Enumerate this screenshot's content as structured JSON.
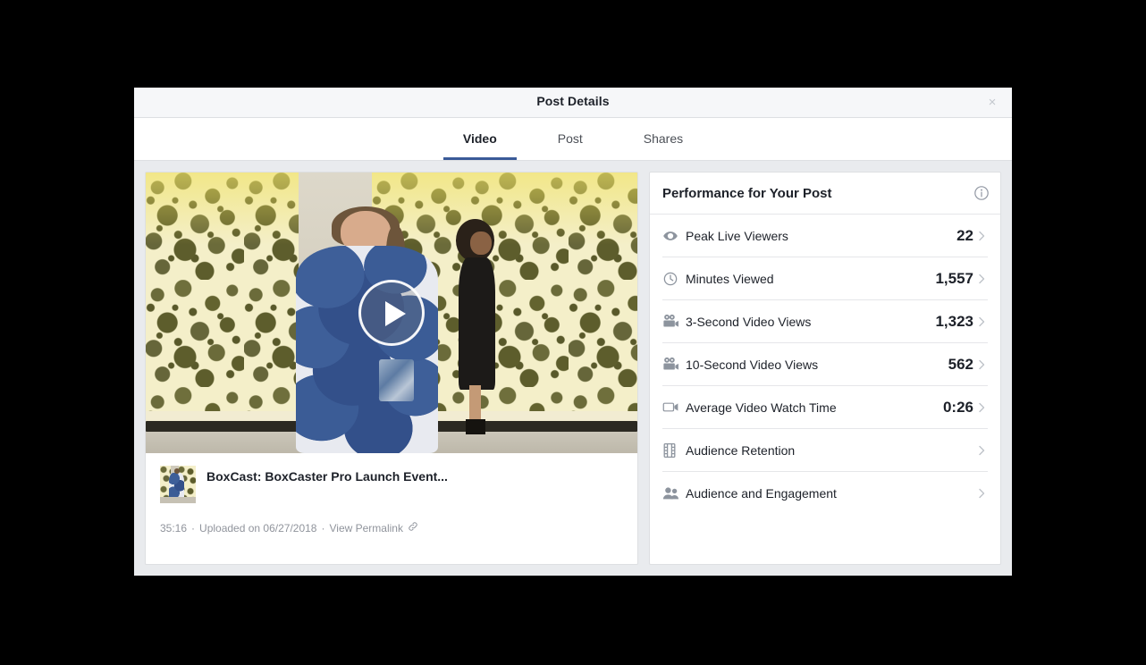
{
  "modal": {
    "title": "Post Details",
    "close_label": "×",
    "close_icon": "close-icon"
  },
  "tabs": [
    {
      "label": "Video",
      "active": true
    },
    {
      "label": "Post",
      "active": false
    },
    {
      "label": "Shares",
      "active": false
    }
  ],
  "video": {
    "play_icon": "play-icon",
    "title": "BoxCast: BoxCaster Pro Launch Event...",
    "duration": "35:16",
    "separator": "·",
    "uploaded": "Uploaded on 06/27/2018",
    "permalink_label": "View Permalink",
    "permalink_icon": "link-icon"
  },
  "performance": {
    "title": "Performance for Your Post",
    "info_icon": "info-icon",
    "metrics": [
      {
        "icon": "eye-icon",
        "label": "Peak Live Viewers",
        "value": "22"
      },
      {
        "icon": "clock-icon",
        "label": "Minutes Viewed",
        "value": "1,557"
      },
      {
        "icon": "movie-camera-icon",
        "label": "3-Second Video Views",
        "value": "1,323"
      },
      {
        "icon": "movie-camera-icon",
        "label": "10-Second Video Views",
        "value": "562"
      },
      {
        "icon": "video-camera-icon",
        "label": "Average Video Watch Time",
        "value": "0:26"
      },
      {
        "icon": "film-strip-icon",
        "label": "Audience Retention",
        "value": ""
      },
      {
        "icon": "people-icon",
        "label": "Audience and Engagement",
        "value": ""
      }
    ]
  },
  "colors": {
    "accent": "#3a5a98",
    "modal_bg": "#e9ebee",
    "card_bg": "#ffffff",
    "text_primary": "#1d2129",
    "text_muted": "#90949c",
    "divider": "#e5e6e9"
  }
}
